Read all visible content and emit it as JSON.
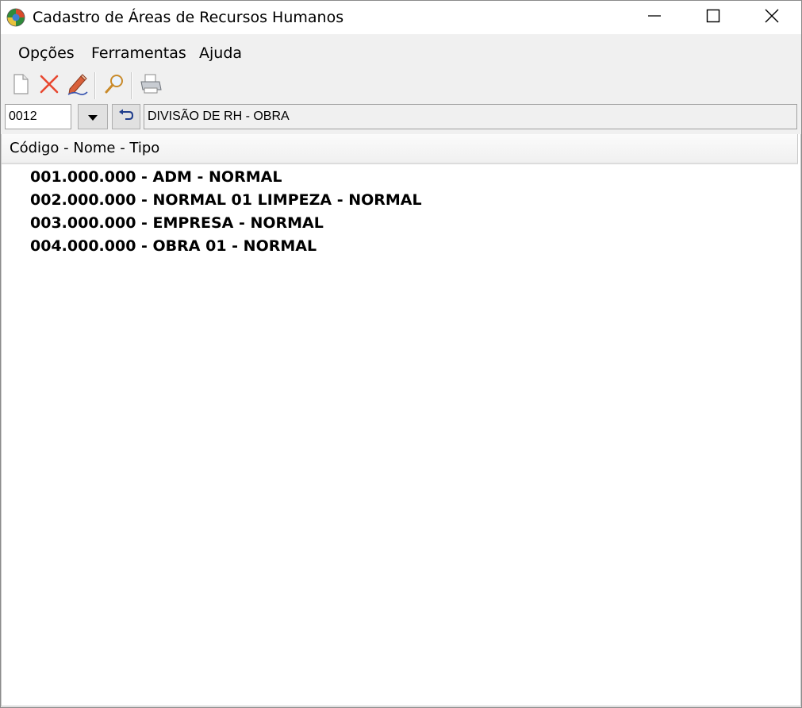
{
  "window": {
    "title": "Cadastro de Áreas de Recursos Humanos",
    "app_icon": "globe-app-icon",
    "controls": [
      "minimize-icon",
      "maximize-icon",
      "close-icon"
    ]
  },
  "menu": {
    "items": [
      {
        "label": "Opções"
      },
      {
        "label": "Ferramentas"
      },
      {
        "label": "Ajuda"
      }
    ]
  },
  "toolbar": {
    "buttons": [
      {
        "icon": "new-document-icon"
      },
      {
        "icon": "delete-x-icon"
      },
      {
        "icon": "edit-pencil-icon"
      },
      {
        "icon": "search-magnifier-icon"
      },
      {
        "icon": "printer-icon"
      }
    ]
  },
  "selector": {
    "code_value": "0012",
    "description": "DIVISÃO DE RH - OBRA"
  },
  "tree": {
    "header": "Código - Nome - Tipo",
    "rows": [
      {
        "text": "001.000.000 - ADM - NORMAL"
      },
      {
        "text": "002.000.000 - NORMAL 01 LIMPEZA - NORMAL"
      },
      {
        "text": "003.000.000 - EMPRESA - NORMAL"
      },
      {
        "text": "004.000.000 - OBRA 01 - NORMAL"
      }
    ]
  },
  "colors": {
    "delete_icon": "#e8472f",
    "undo_icon": "#1e3c8c",
    "window_bg": "#f0f0f0"
  }
}
